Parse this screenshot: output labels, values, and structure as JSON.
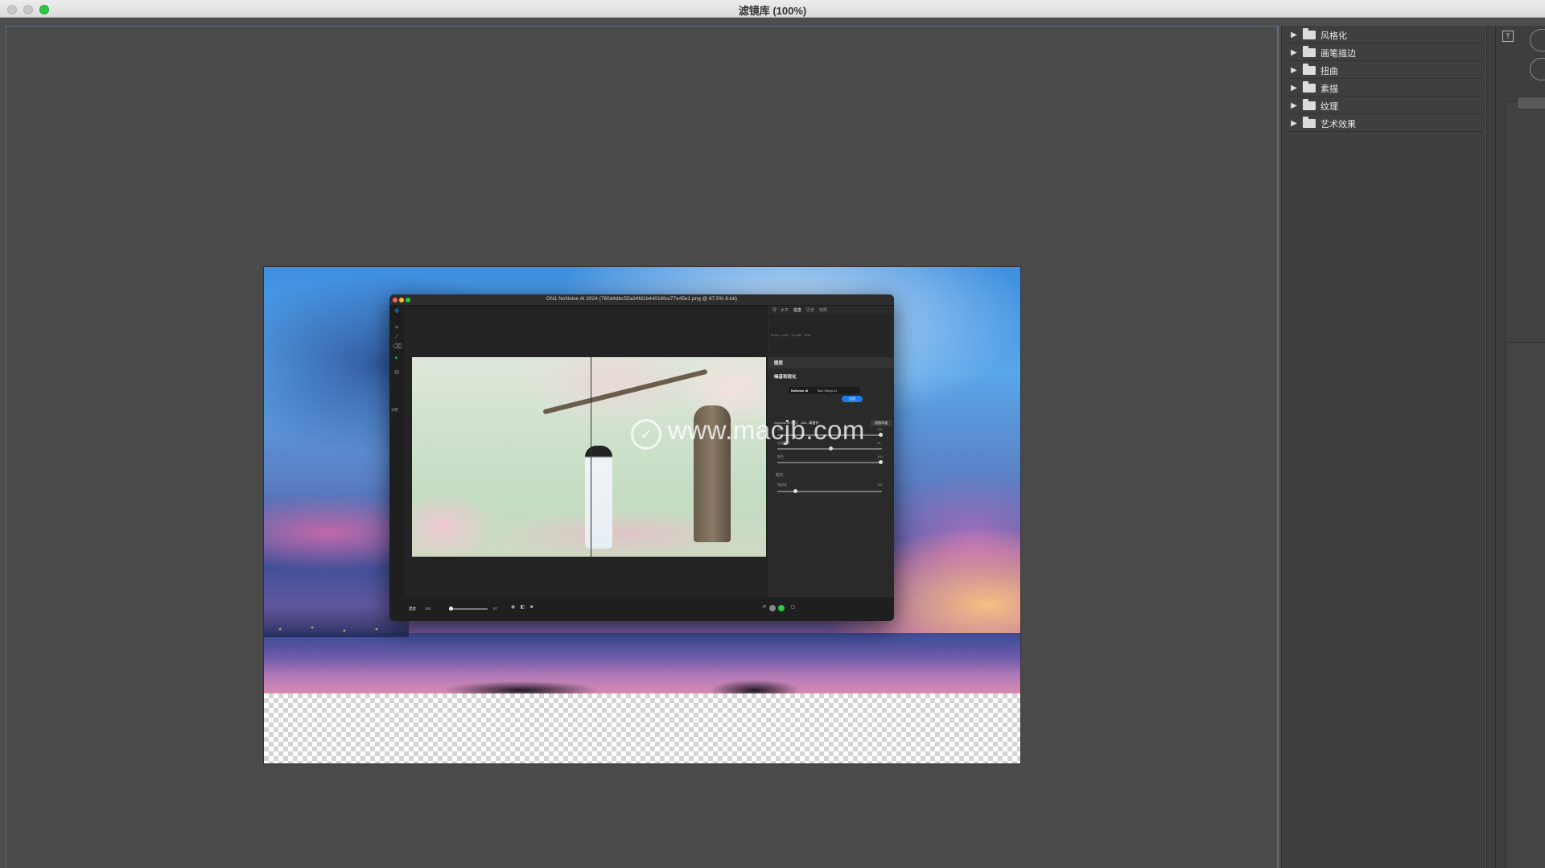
{
  "window": {
    "title": "滤镜库 (100%)"
  },
  "on1": {
    "title": "ON1 NoNoise AI 2024 (760d4dbc55a34fd1b44016fce77e45e1.png @ 87.5% 8-bit)",
    "tabs": [
      "导",
      "水平",
      "信息",
      "历史",
      "快照"
    ],
    "active_tab": "信息",
    "info_text": "2048 x 1150 · 3.5 MB · PNG",
    "section_layers": "图层",
    "section_noise": "噪音和锐化",
    "pill_left": "NoNoise AI",
    "pill_right": "Tack Sharp AI",
    "badge": "应用",
    "model_label": "NoNoise AI 模型",
    "model_value": "202...高细节",
    "filter_button": "滤镜车道",
    "slider1_label": "亮度",
    "slider1_value": "100",
    "slider2_label": "加强细节",
    "slider2_value": "30",
    "slider3_label": "颜色",
    "slider3_value": "100",
    "sharpen_section": "锐化",
    "slider4_label": "微锐化",
    "slider4_value": "100",
    "tool_label": "调整",
    "bottom_mode": "混合",
    "bottom_opacity": "100",
    "bottom_value": "87"
  },
  "watermark": {
    "text": "www.macjb.com"
  },
  "filter_gallery": {
    "items": [
      {
        "label": "风格化"
      },
      {
        "label": "画笔描边"
      },
      {
        "label": "扭曲"
      },
      {
        "label": "素描"
      },
      {
        "label": "纹理"
      },
      {
        "label": "艺术效果"
      }
    ]
  },
  "icons": {
    "expand_arrow": "▶",
    "collapse": "⤒"
  },
  "colors": {
    "background": "#4d4d4d",
    "panel": "#3f3f3f",
    "accent_green": "#2ac845",
    "on1_badge": "#1e7bea"
  }
}
